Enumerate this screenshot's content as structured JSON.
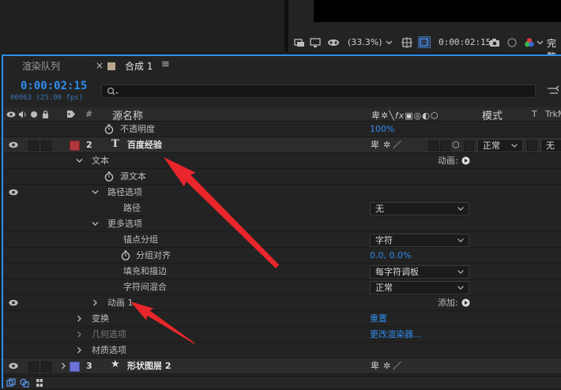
{
  "viewer": {
    "zoom": "(33.3%)",
    "timecode": "0:00:02:15",
    "quality": "完整"
  },
  "tabs": {
    "render_queue": "渲染队列",
    "comp": "合成 1"
  },
  "timeline": {
    "timecode": "0:00:02:15",
    "frame_info": "00063 (25.00 fps)",
    "search_placeholder": "",
    "col_hash": "#",
    "col_source": "源名称",
    "col_mode": "模式",
    "col_t": "T",
    "col_trkmat": "TrkM"
  },
  "rows": {
    "opacity": {
      "label": "不透明度",
      "value": "100%"
    },
    "layer2": {
      "index": "2",
      "name": "百度经验",
      "mode": "正常",
      "trk": "无"
    },
    "text_group": {
      "label": "文本",
      "animate": "动画:"
    },
    "source_text": {
      "label": "源文本"
    },
    "path_options": {
      "label": "路径选项"
    },
    "path": {
      "label": "路径",
      "value": "无"
    },
    "more_options": {
      "label": "更多选项"
    },
    "anchor_grouping": {
      "label": "锚点分组",
      "value": "字符"
    },
    "grouping_alignment": {
      "label": "分组对齐",
      "value": "0.0, 0.0%"
    },
    "fill_stroke": {
      "label": "填充和描边",
      "value": "每字符调板"
    },
    "inter_char_blend": {
      "label": "字符间混合",
      "value": "正常"
    },
    "animator1": {
      "label": "动画 1",
      "add": "添加:"
    },
    "transform": {
      "label": "变换",
      "value": "重置"
    },
    "geometry": {
      "label": "几何选项",
      "value": "更改渲染器..."
    },
    "material": {
      "label": "材质选项"
    },
    "layer3": {
      "index": "3",
      "name": "形状图层 2"
    }
  },
  "colors": {
    "accent_blue": "#2d8ceb",
    "layer2_label": "#b0383c",
    "layer3_label": "#6b74d6",
    "arrow_red": "#e8262b"
  }
}
